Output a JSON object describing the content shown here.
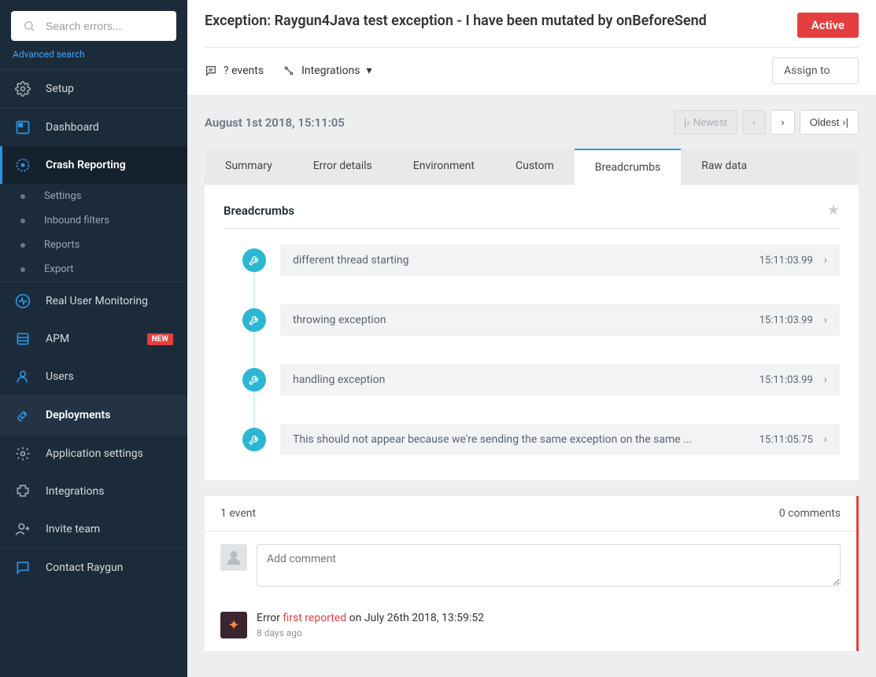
{
  "search": {
    "placeholder": "Search errors..."
  },
  "advanced_search": "Advanced search",
  "nav": {
    "setup": "Setup",
    "dashboard": "Dashboard",
    "crash_reporting": "Crash Reporting",
    "subs": [
      "Settings",
      "Inbound filters",
      "Reports",
      "Export"
    ],
    "rum": "Real User Monitoring",
    "apm": "APM",
    "apm_badge": "NEW",
    "users": "Users",
    "deployments": "Deployments",
    "app_settings": "Application settings",
    "integrations": "Integrations",
    "invite": "Invite team",
    "contact": "Contact Raygun"
  },
  "header": {
    "title": "Exception: Raygun4Java test exception - I have been mutated by onBeforeSend",
    "status": "Active",
    "events": "? events",
    "integrations": "Integrations",
    "assign": "Assign to"
  },
  "pager": {
    "date": "August 1st 2018, 15:11:05",
    "newest": "Newest",
    "oldest": "Oldest"
  },
  "tabs": [
    "Summary",
    "Error details",
    "Environment",
    "Custom",
    "Breadcrumbs",
    "Raw data"
  ],
  "active_tab": 4,
  "panel": {
    "title": "Breadcrumbs",
    "items": [
      {
        "msg": "different thread starting",
        "time": "15:11:03.99"
      },
      {
        "msg": "throwing exception",
        "time": "15:11:03.99"
      },
      {
        "msg": "handling exception",
        "time": "15:11:03.99"
      },
      {
        "msg": "This should not appear because we're sending the same exception on the same ...",
        "time": "15:11:05.75"
      }
    ]
  },
  "comments": {
    "event_count": "1 event",
    "comment_count": "0 comments",
    "placeholder": "Add comment",
    "event_prefix": "Error ",
    "event_highlight": "first reported",
    "event_suffix": " on July 26th 2018, 13:59:52",
    "event_ago": "8 days ago"
  }
}
